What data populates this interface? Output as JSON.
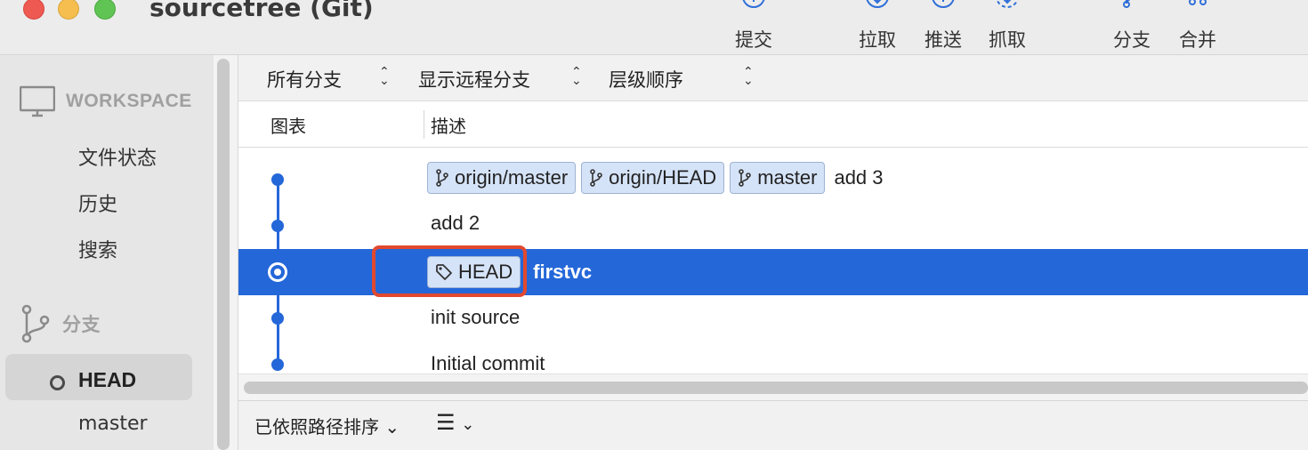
{
  "window": {
    "title": "sourcetree (Git)"
  },
  "toolbar": {
    "items": [
      {
        "label": "提交",
        "icon": "plus-circle-icon"
      },
      {
        "label": "拉取",
        "icon": "arrow-down-circle-icon"
      },
      {
        "label": "推送",
        "icon": "arrow-up-circle-icon"
      },
      {
        "label": "抓取",
        "icon": "fetch-circle-icon"
      },
      {
        "label": "分支",
        "icon": "branch-icon"
      },
      {
        "label": "合并",
        "icon": "merge-icon"
      }
    ]
  },
  "sidebar": {
    "workspace_header": "WORKSPACE",
    "workspace_items": [
      "文件状态",
      "历史",
      "搜索"
    ],
    "branch_header": "分支",
    "head_label": "HEAD",
    "master_label": "master"
  },
  "filters": {
    "branches": "所有分支",
    "remote": "显示远程分支",
    "order": "层级顺序"
  },
  "columns": {
    "graph": "图表",
    "description": "描述"
  },
  "commits": [
    {
      "refs": [
        "origin/master",
        "origin/HEAD",
        "master"
      ],
      "message": "add 3"
    },
    {
      "refs": [],
      "message": "add 2"
    },
    {
      "tag": "HEAD",
      "message": "firstvc",
      "selected": true
    },
    {
      "refs": [],
      "message": "init source"
    },
    {
      "refs": [],
      "message": "Initial commit"
    }
  ],
  "bottom": {
    "sort_label": "已依照路径排序",
    "list_icon": "list-icon"
  },
  "colors": {
    "accent": "#2467d9",
    "highlight": "#e2492f"
  }
}
